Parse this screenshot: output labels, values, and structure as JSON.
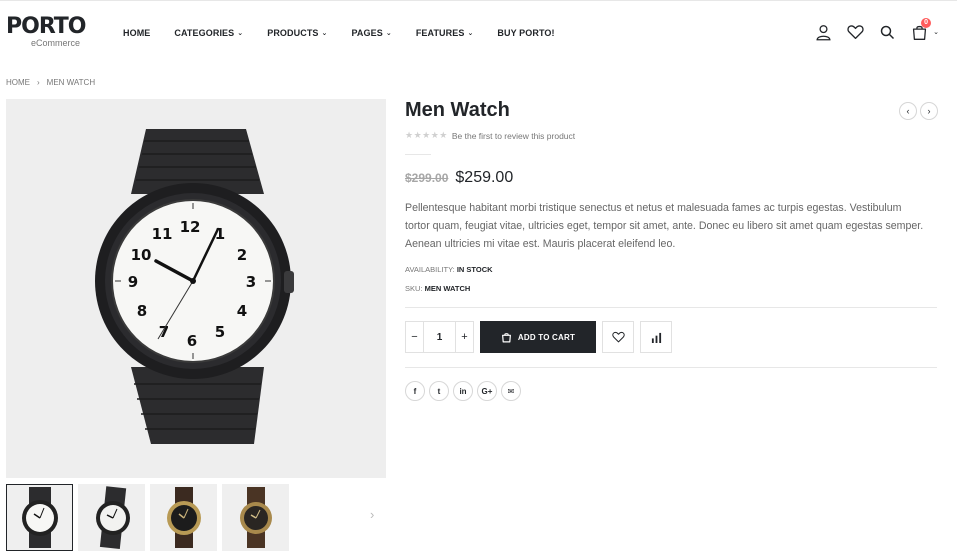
{
  "header": {
    "logo": {
      "main": "PORTO",
      "sub": "eCommerce"
    },
    "nav": [
      {
        "label": "HOME",
        "dropdown": false
      },
      {
        "label": "CATEGORIES",
        "dropdown": true
      },
      {
        "label": "PRODUCTS",
        "dropdown": true
      },
      {
        "label": "PAGES",
        "dropdown": true
      },
      {
        "label": "FEATURES",
        "dropdown": true
      },
      {
        "label": "BUY PORTO!",
        "dropdown": false
      }
    ],
    "icons": [
      "user-icon",
      "heart-icon",
      "search-icon",
      "cart-icon"
    ],
    "cart_count": "0"
  },
  "breadcrumb": {
    "home": "HOME",
    "current": "MEN WATCH"
  },
  "product": {
    "title": "Men Watch",
    "rating_text": "Be the first to review this product",
    "old_price": "$299.00",
    "price": "$259.00",
    "description": "Pellentesque habitant morbi tristique senectus et netus et malesuada fames ac turpis egestas. Vestibulum tortor quam, feugiat vitae, ultricies eget, tempor sit amet, ante. Donec eu libero sit amet quam egestas semper. Aenean ultricies mi vitae est. Mauris placerat eleifend leo.",
    "availability_label": "AVAILABILITY:",
    "availability_value": "IN STOCK",
    "sku_label": "SKU:",
    "sku_value": "MEN WATCH",
    "quantity": "1",
    "add_to_cart": "ADD TO CART"
  },
  "controls": {
    "minus": "−",
    "plus": "+",
    "prev": "‹",
    "next": "›"
  },
  "socials": [
    {
      "name": "facebook-icon",
      "glyph": "f"
    },
    {
      "name": "twitter-icon",
      "glyph": "t"
    },
    {
      "name": "linkedin-icon",
      "glyph": "in"
    },
    {
      "name": "google-plus-icon",
      "glyph": "G+"
    },
    {
      "name": "email-icon",
      "glyph": "✉"
    }
  ],
  "colors": {
    "dark": "#222529",
    "badge": "#ff5b5b",
    "muted": "#777777"
  }
}
